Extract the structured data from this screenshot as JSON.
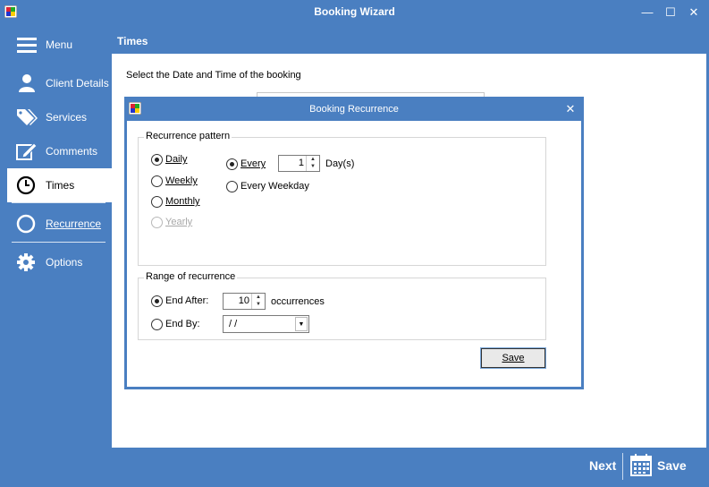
{
  "window": {
    "title": "Booking Wizard"
  },
  "sidebar": {
    "items": [
      {
        "label": "Menu",
        "icon": "hamburger-menu-icon"
      },
      {
        "label": "Client Details",
        "icon": "person-icon"
      },
      {
        "label": "Services",
        "icon": "tags-icon"
      },
      {
        "label": "Comments",
        "icon": "pencil-edit-icon"
      },
      {
        "label": "Times",
        "icon": "clock-icon",
        "active": true
      },
      {
        "label": "Recurrence",
        "icon": "circle-icon"
      },
      {
        "label": "Options",
        "icon": "gear-icon"
      }
    ]
  },
  "main": {
    "header": "Times",
    "instruction": "Select the Date and Time of the booking"
  },
  "footer": {
    "next_label": "Next",
    "save_label": "Save"
  },
  "dialog": {
    "title": "Booking Recurrence",
    "pattern": {
      "group_label": "Recurrence pattern",
      "options": [
        "Daily",
        "Weekly",
        "Monthly",
        "Yearly"
      ],
      "selected": "Daily",
      "disabled": [
        "Yearly"
      ],
      "every_label": "Every",
      "every_value": "1",
      "every_unit": "Day(s)",
      "every_weekday_label": "Every Weekday"
    },
    "range": {
      "group_label": "Range of recurrence",
      "end_after_label": "End After:",
      "end_after_value": "10",
      "occurrences_label": "occurrences",
      "end_by_label": "End By:",
      "end_by_value": "/   /"
    },
    "save_label": "Save"
  },
  "colors": {
    "accent": "#4a7fc1",
    "active_bg": "#ffffff"
  }
}
